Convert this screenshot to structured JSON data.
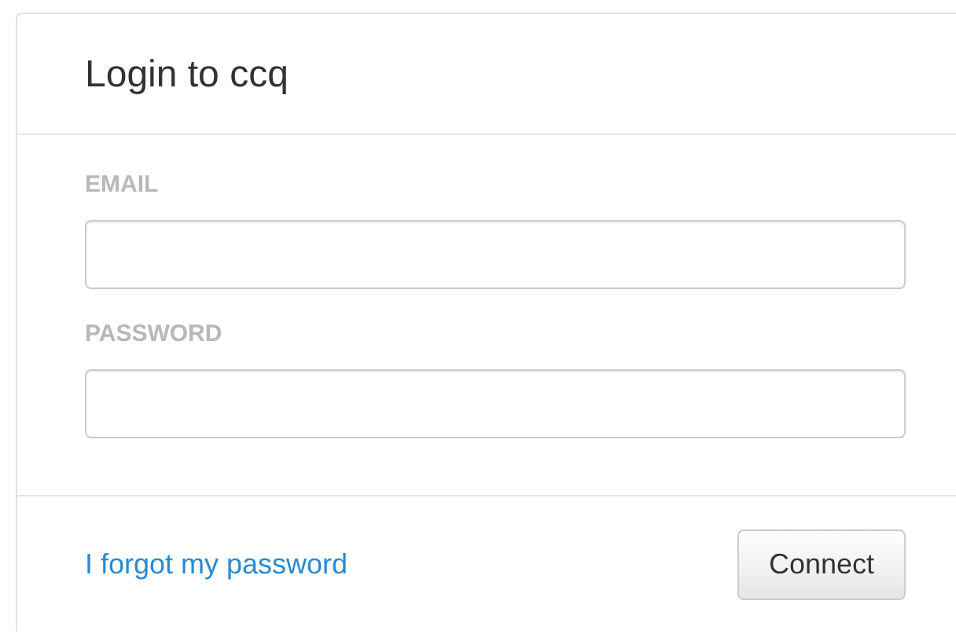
{
  "dialog": {
    "title": "Login to ccq",
    "fields": [
      {
        "label": "EMAIL"
      },
      {
        "label": "PASSWORD"
      }
    ],
    "forgot_link": "I forgot my password",
    "submit_button": "Connect"
  }
}
